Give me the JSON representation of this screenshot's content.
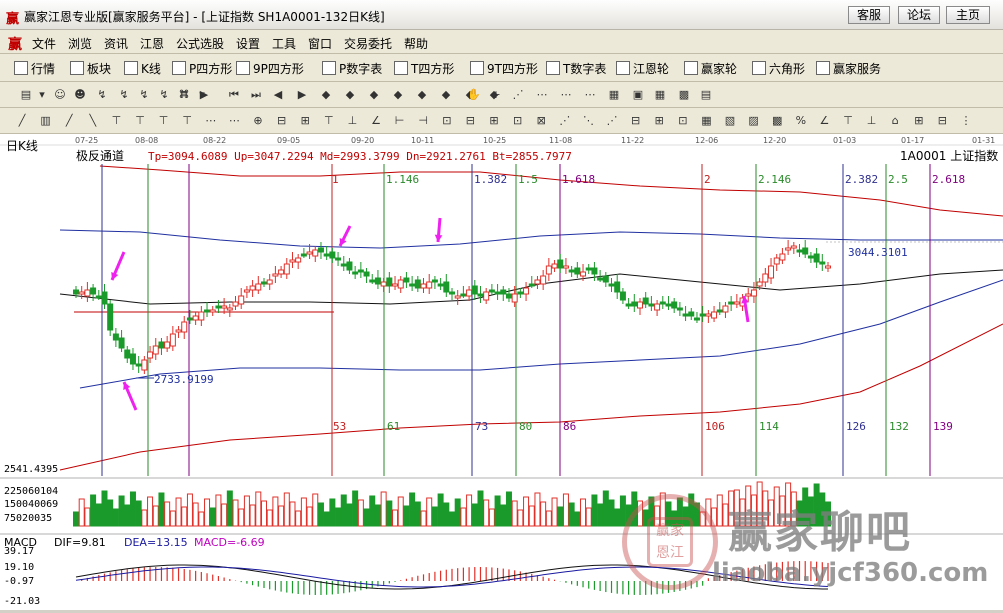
{
  "window": {
    "title": "赢家江恩专业版[赢家服务平台] - [上证指数  SH1A0001-132日K线]",
    "buttons": [
      "客服",
      "论坛",
      "主页"
    ]
  },
  "menu": [
    "文件",
    "浏览",
    "资讯",
    "江恩",
    "公式选股",
    "设置",
    "工具",
    "窗口",
    "交易委托",
    "帮助"
  ],
  "toolbar1": [
    {
      "icon": "grid-icon",
      "label": "行情"
    },
    {
      "icon": "blocks-icon",
      "label": "板块"
    },
    {
      "icon": "candlestick-icon",
      "label": "K线"
    },
    {
      "icon": "ps-icon",
      "label": "P四方形"
    },
    {
      "icon": "9p-icon",
      "label": "9P四方形"
    },
    {
      "icon": "pn-icon",
      "label": "P数字表"
    },
    {
      "icon": "ts-icon",
      "label": "T四方形"
    },
    {
      "icon": "t9-icon",
      "label": "9T四方形"
    },
    {
      "icon": "tn-icon",
      "label": "T数字表"
    },
    {
      "icon": "gann-wheel-icon",
      "label": "江恩轮"
    },
    {
      "icon": "win-wheel-icon",
      "label": "赢家轮"
    },
    {
      "icon": "hexagon-icon",
      "label": "六角形"
    },
    {
      "icon": "dollar-icon",
      "label": "赢家服务"
    }
  ],
  "chart": {
    "panel_label": "日K线",
    "indicator": "极反通道",
    "params": "Tp=3094.6089  Up=3047.2294  Md=2993.3799  Dn=2921.2761  Bt=2855.7977",
    "symbol": "1A0001  上证指数",
    "date_ticks": [
      "07-25",
      "08-08",
      "08-22",
      "09-05",
      "09-20",
      "10-11",
      "10-25",
      "11-08",
      "11-22",
      "12-06",
      "12-20",
      "01-03",
      "01-17",
      "01-31"
    ],
    "ratio_labels": [
      "1",
      "1.146",
      "1.382",
      "1.5",
      "1.618",
      "2",
      "2.146",
      "2.382",
      "2.5",
      "2.618"
    ],
    "count_labels": [
      "53",
      "61",
      "73",
      "80",
      "86",
      "106",
      "114",
      "126",
      "132",
      "139"
    ],
    "low_label": "2733.9199",
    "high_label": "3044.3101",
    "price_min_label": "2541.4395",
    "volume_axis": [
      "225060104",
      "150040069",
      "75020035"
    ],
    "macd_label": "MACD",
    "dif": "DIF=9.81",
    "dea": "DEA=13.15",
    "macd": "MACD=-6.69",
    "macd_axis": [
      "39.17",
      "19.10",
      "-0.97",
      "-21.03"
    ]
  },
  "watermark": {
    "title": "赢家聊吧",
    "url": "liaoba.yjcf360.com",
    "seal_text": [
      "赢",
      "恩",
      "家",
      "江"
    ]
  },
  "colors": {
    "up": "#e0302a",
    "down": "#1a9a2a",
    "channel_red": "#c00000",
    "channel_blue": "#2030a0",
    "vline_red": "#c02020",
    "vline_green": "#2a8a2a",
    "vline_blue": "#303090",
    "vline_purple": "#800080",
    "arrow": "#ee22ee"
  }
}
